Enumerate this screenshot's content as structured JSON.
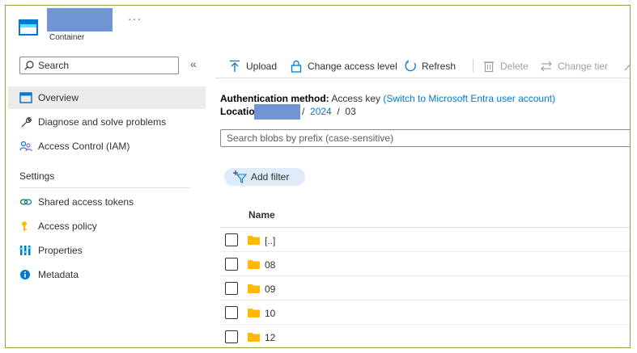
{
  "header": {
    "subtitle": "Container",
    "more_label": "···"
  },
  "sidebar": {
    "search_placeholder": "Search",
    "collapse_label": "«",
    "items": [
      {
        "label": "Overview",
        "icon": "overview-icon",
        "selected": true
      },
      {
        "label": "Diagnose and solve problems",
        "icon": "wrench-icon"
      },
      {
        "label": "Access Control (IAM)",
        "icon": "people-icon"
      }
    ],
    "settings_header": "Settings",
    "settings_items": [
      {
        "label": "Shared access tokens",
        "icon": "link-icon"
      },
      {
        "label": "Access policy",
        "icon": "key-icon"
      },
      {
        "label": "Properties",
        "icon": "properties-icon"
      },
      {
        "label": "Metadata",
        "icon": "info-icon"
      }
    ]
  },
  "toolbar": {
    "upload": "Upload",
    "change_access_level": "Change access level",
    "refresh": "Refresh",
    "delete": "Delete",
    "change_tier": "Change tier"
  },
  "auth": {
    "label": "Authentication method:",
    "value": "Access key",
    "link": "(Switch to Microsoft Entra user account)"
  },
  "location": {
    "label": "Locatio",
    "path_sep1": "/",
    "year": "2024",
    "path_sep2": "/",
    "month": "03"
  },
  "blob_search_placeholder": "Search blobs by prefix (case-sensitive)",
  "add_filter": "Add filter",
  "table": {
    "column_name": "Name",
    "rows": [
      "[..]",
      "08",
      "09",
      "10",
      "12"
    ]
  },
  "colors": {
    "accent": "#0078d4",
    "redaction": "#6f96d2",
    "folder": "#ffb900",
    "frame_border": "#8aa63f"
  }
}
